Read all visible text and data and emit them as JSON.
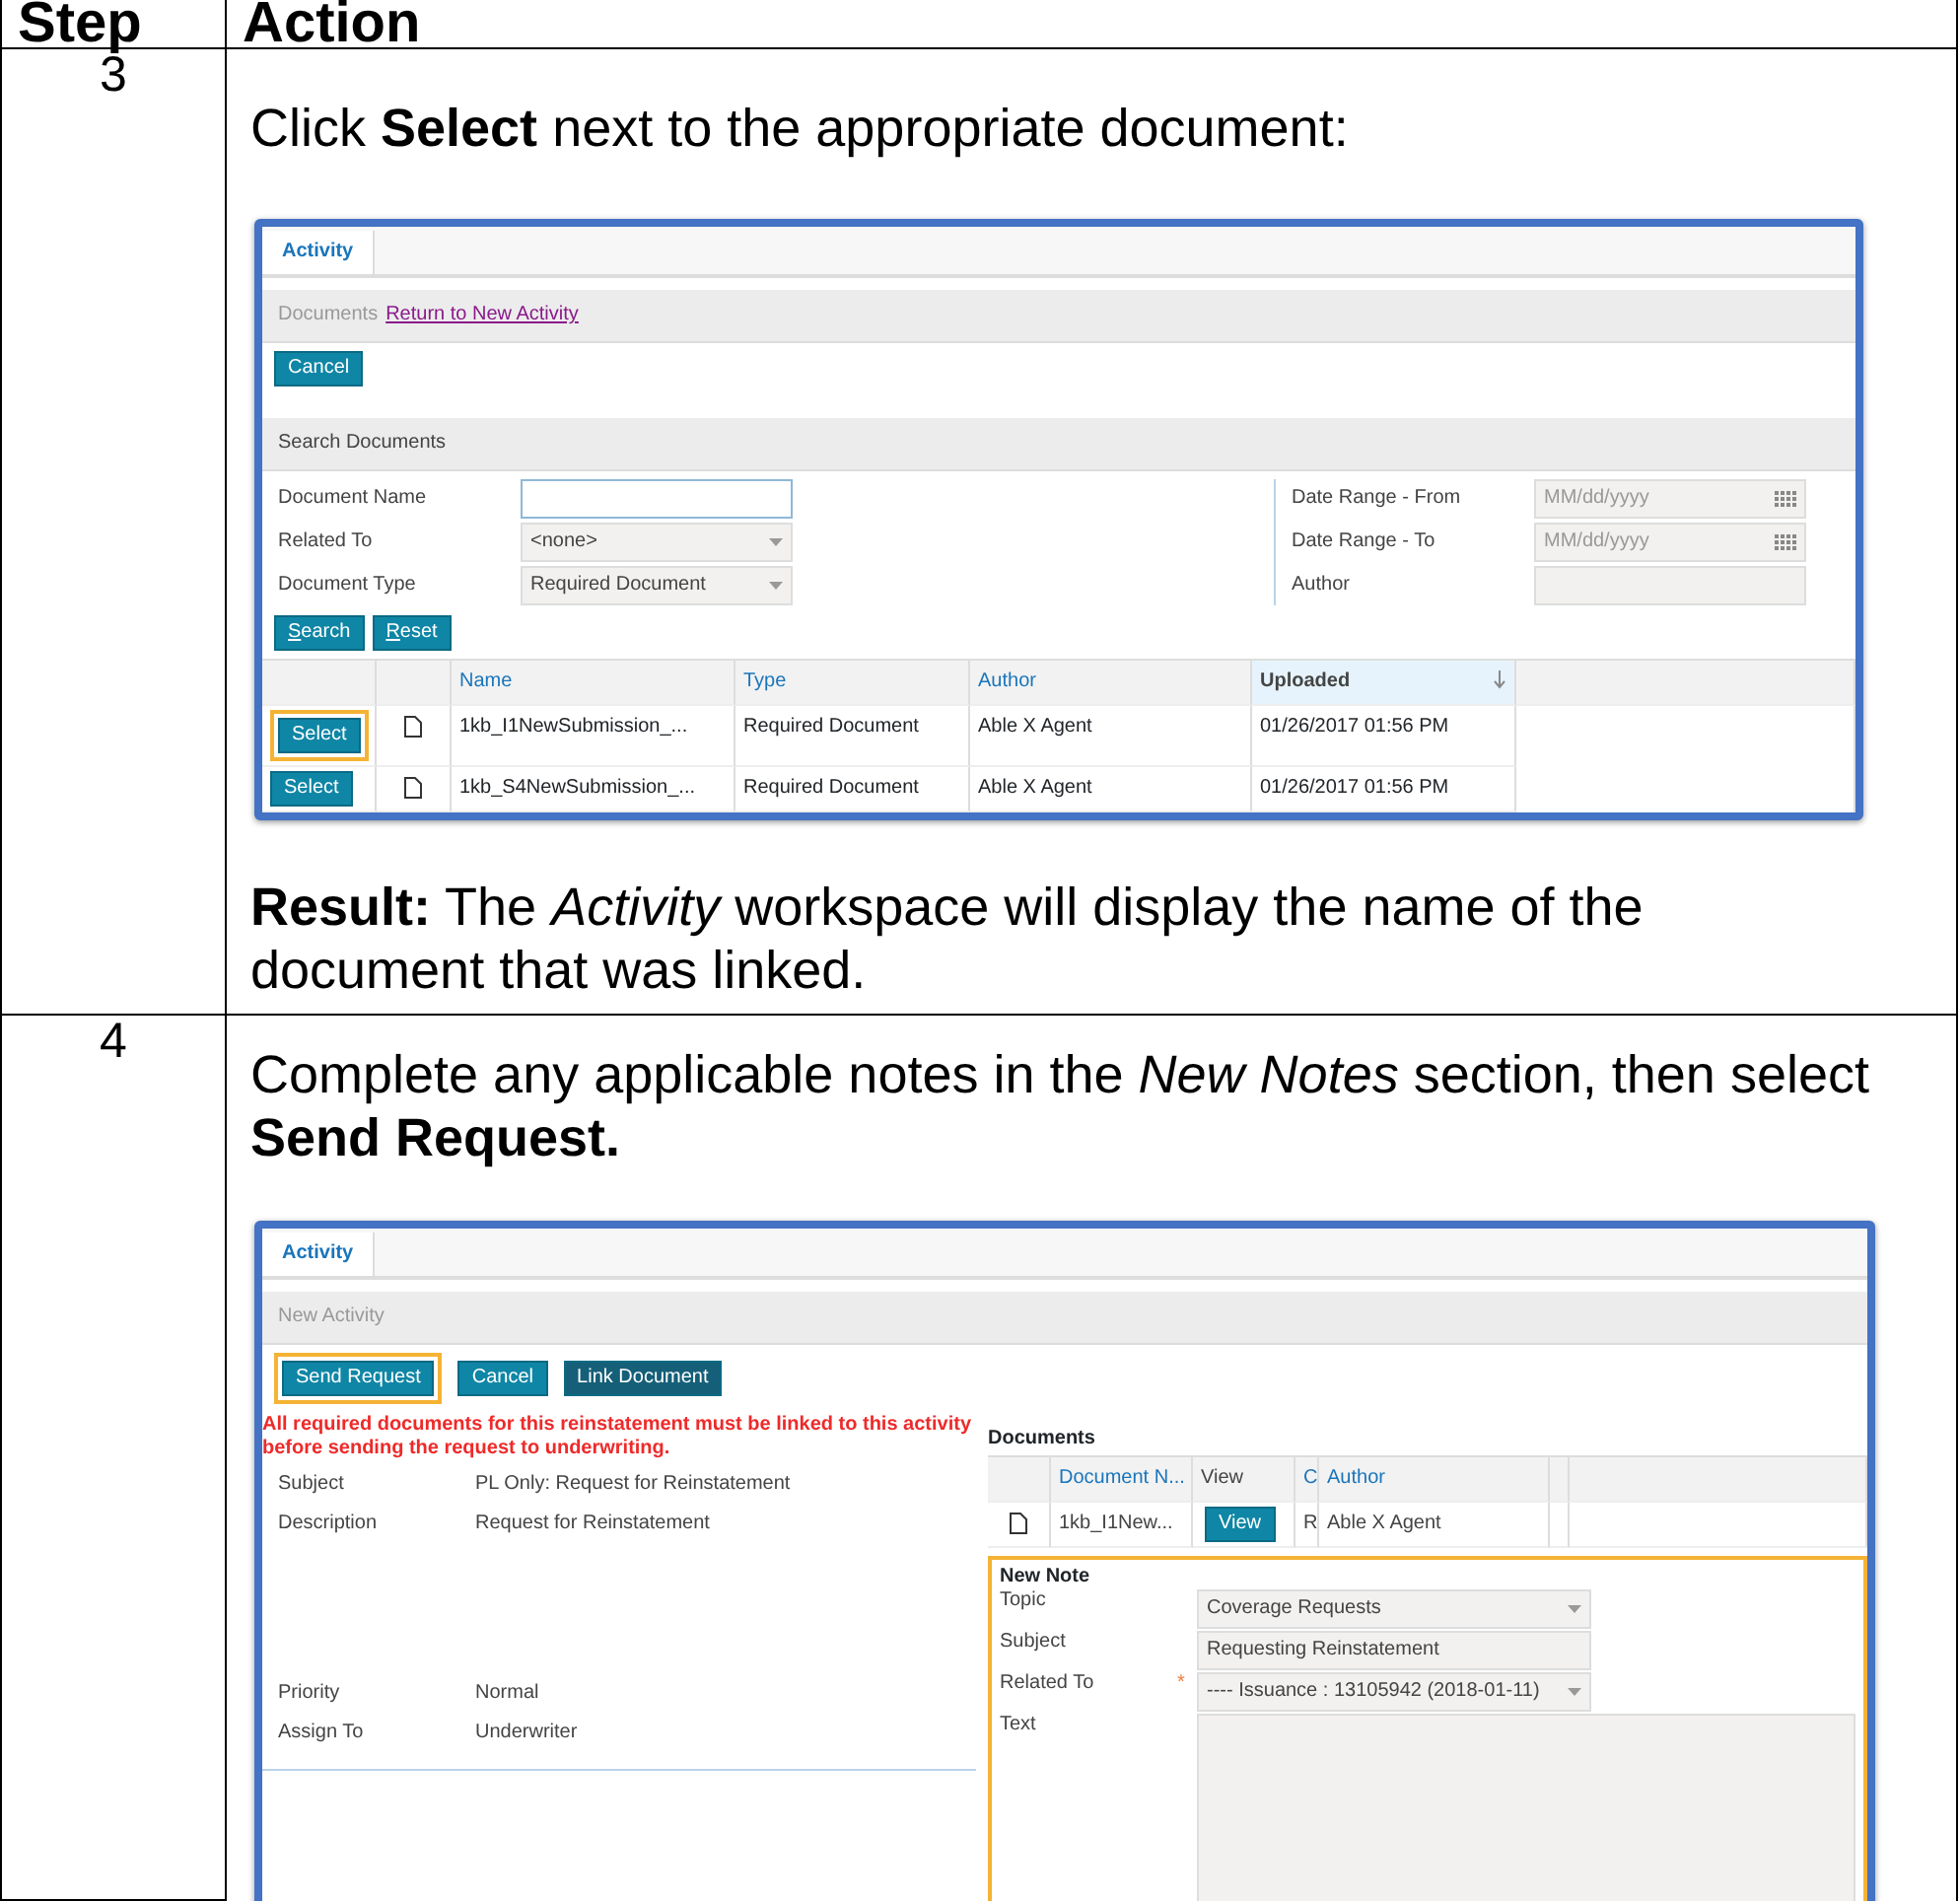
{
  "table": {
    "columns": [
      "Step",
      "Action"
    ],
    "rows": [
      {
        "step": "3",
        "instruction": "Click **Select** next to the appropriate document:",
        "screenshot": {
          "kind": "search",
          "tab": "Activity",
          "breadcrumb": "Documents",
          "breadcrumb_link": "Return to New Activity",
          "buttons": [
            {
              "label": "Cancel",
              "highlighted": false
            }
          ],
          "section": "Search Documents",
          "fields_left": [
            {
              "label": "Document Name",
              "kind": "text"
            },
            {
              "label": "Related To",
              "kind": "select",
              "value": "<none>"
            },
            {
              "label": "Document Type",
              "kind": "select",
              "value": "Required Document"
            }
          ],
          "fields_right": [
            {
              "label": "Date Range - From",
              "kind": "date",
              "placeholder": "MM/dd/yyyy"
            },
            {
              "label": "Date Range - To",
              "kind": "date",
              "placeholder": "MM/dd/yyyy"
            },
            {
              "label": "Author",
              "kind": "text"
            }
          ],
          "actions": [
            "Search",
            "Reset"
          ],
          "columns": [
            {
              "label": "Name",
              "sorted": false
            },
            {
              "label": "Type",
              "sorted": false
            },
            {
              "label": "Author",
              "sorted": false
            },
            {
              "label": "Uploaded",
              "sorted": true
            }
          ],
          "rows": [
            {
              "button": "Select",
              "highlighted": true,
              "name": "1kb_I1NewSubmission_...",
              "type": "Required Document",
              "author": "Able X Agent",
              "uploaded": "01/26/2017 01:56 PM"
            },
            {
              "button": "Select",
              "highlighted": false,
              "name": "1kb_S4NewSubmission_...",
              "type": "Required Document",
              "author": "Able X Agent",
              "uploaded": "01/26/2017 01:56 PM"
            }
          ]
        },
        "result": "**Result:** The *Activity* workspace will display the name of the document that was linked."
      },
      {
        "step": "4",
        "instruction": "Complete any applicable notes in the *New Notes* section, then select **Send Request.**",
        "screenshot": {
          "kind": "activity",
          "tab": "Activity",
          "breadcrumb": "New Activity",
          "buttons": [
            {
              "label": "Send Request",
              "highlighted": true,
              "dark": false
            },
            {
              "label": "Cancel",
              "highlighted": false,
              "dark": false
            },
            {
              "label": "Link Document",
              "highlighted": false,
              "dark": true
            }
          ],
          "warning": "All required documents for this reinstatement must be linked to this activity before sending the request to underwriting.",
          "details": [
            {
              "label": "Subject",
              "value": "PL Only: Request for Reinstatement"
            },
            {
              "label": "Description",
              "value": "Request for Reinstatement"
            },
            {
              "label": "Priority",
              "value": "Normal"
            },
            {
              "label": "Assign To",
              "value": "Underwriter"
            }
          ],
          "documents": {
            "title": "Documents",
            "columns": [
              "Document N...",
              "View",
              "C",
              "Author"
            ],
            "rows": [
              {
                "name": "1kb_I1New...",
                "view": "View",
                "c": "R",
                "author": "Able X Agent"
              }
            ]
          },
          "note": {
            "title": "New Note",
            "highlighted": true,
            "fields": [
              {
                "label": "Topic",
                "kind": "select",
                "value": "Coverage Requests"
              },
              {
                "label": "Subject",
                "kind": "text",
                "value": "Requesting Reinstatement"
              },
              {
                "label": "Related To",
                "kind": "select",
                "required_mark": "*",
                "value": "---- Issuance : 13105942 (2018-01-11)"
              },
              {
                "label": "Text",
                "kind": "textarea"
              }
            ]
          }
        }
      }
    ]
  }
}
